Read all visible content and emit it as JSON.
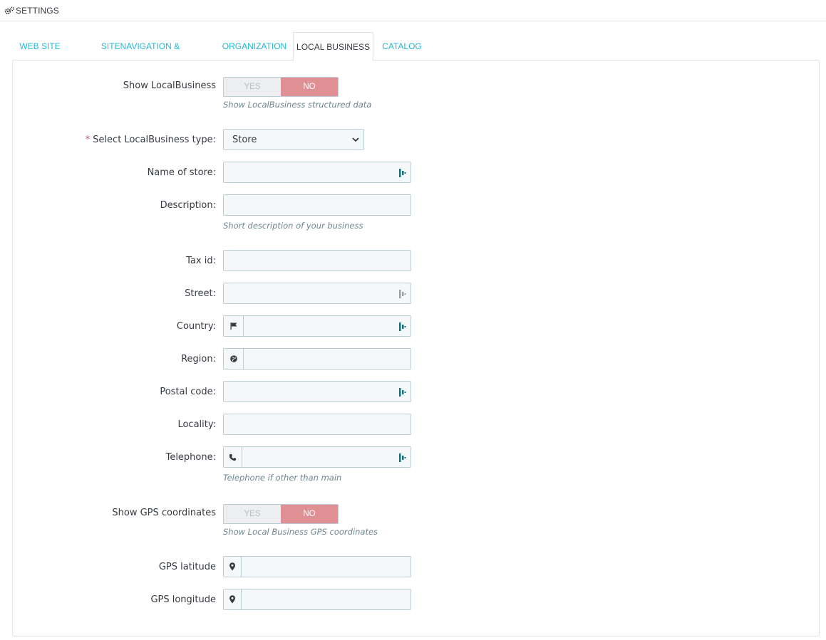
{
  "header": {
    "title": "SETTINGS",
    "icon": "gears-icon"
  },
  "tabs": [
    {
      "label": "WEB SITE",
      "active": false
    },
    {
      "label": "SITENAVIGATION & BREADCRUMBS",
      "active": false
    },
    {
      "label": "ORGANIZATION",
      "active": false
    },
    {
      "label": "LOCAL BUSINESS",
      "active": true
    },
    {
      "label": "CATALOG",
      "active": false
    }
  ],
  "form": {
    "show_localbusiness": {
      "label": "Show LocalBusiness",
      "yes": "YES",
      "no": "NO",
      "value": "NO",
      "help": "Show LocalBusiness structured data"
    },
    "business_type": {
      "required_mark": "*",
      "label": "Select LocalBusiness type:",
      "value": "Store"
    },
    "name_of_store": {
      "label": "Name of store:",
      "value": ""
    },
    "description": {
      "label": "Description:",
      "value": "",
      "help": "Short description of your business"
    },
    "tax_id": {
      "label": "Tax id:",
      "value": ""
    },
    "street": {
      "label": "Street:",
      "value": ""
    },
    "country": {
      "label": "Country:",
      "value": "",
      "addon_icon": "flag-icon"
    },
    "region": {
      "label": "Region:",
      "value": "",
      "addon_icon": "globe-icon"
    },
    "postal_code": {
      "label": "Postal code:",
      "value": ""
    },
    "locality": {
      "label": "Locality:",
      "value": ""
    },
    "telephone": {
      "label": "Telephone:",
      "value": "",
      "addon_icon": "phone-icon",
      "help": "Telephone if other than main"
    },
    "show_gps": {
      "label": "Show GPS coordinates",
      "yes": "YES",
      "no": "NO",
      "value": "NO",
      "help": "Show Local Business GPS coordinates"
    },
    "gps_latitude": {
      "label": "GPS latitude",
      "value": "",
      "addon_icon": "map-marker-icon"
    },
    "gps_longitude": {
      "label": "GPS longitude",
      "value": "",
      "addon_icon": "map-marker-icon"
    }
  },
  "colors": {
    "accent": "#25b9d7",
    "switch_on": "#e08f95",
    "text": "#363a41",
    "help_text": "#6c868e"
  }
}
